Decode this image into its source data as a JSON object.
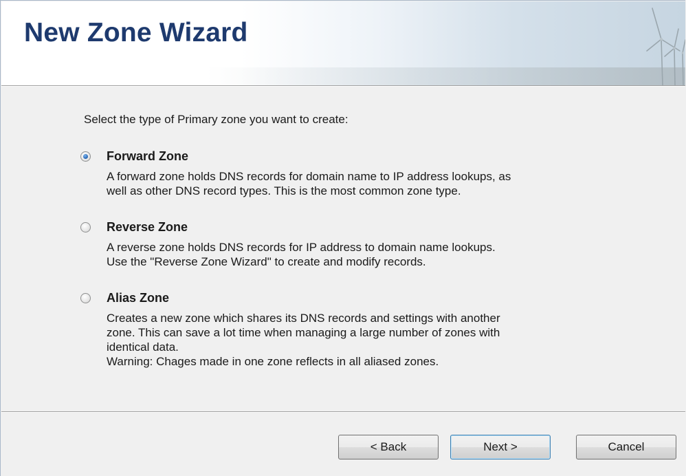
{
  "wizard": {
    "title": "New Zone Wizard"
  },
  "prompt": "Select the type of Primary zone you want to create:",
  "options": [
    {
      "label": "Forward Zone",
      "checked": true,
      "description": [
        "A forward zone holds DNS records for domain name to IP address lookups, as",
        "well as other DNS record types. This is the most common zone type."
      ]
    },
    {
      "label": "Reverse Zone",
      "checked": false,
      "description": [
        "A reverse zone holds DNS records for IP address to domain name lookups.",
        "Use the \"Reverse Zone Wizard\" to create and modify records."
      ]
    },
    {
      "label": "Alias Zone",
      "checked": false,
      "description": [
        "Creates a new zone which shares its DNS records and settings with another",
        "zone. This can save a lot time when managing a large number of zones with",
        "identical data.",
        "Warning: Chages made in one zone reflects in all aliased zones."
      ]
    }
  ],
  "buttons": {
    "back": "< Back",
    "next": "Next >",
    "cancel": "Cancel"
  },
  "colors": {
    "title": "#1e3a6e",
    "default_button_border": "#3c7fb1"
  },
  "icons": {
    "banner_art": "wind-turbines-icon"
  }
}
